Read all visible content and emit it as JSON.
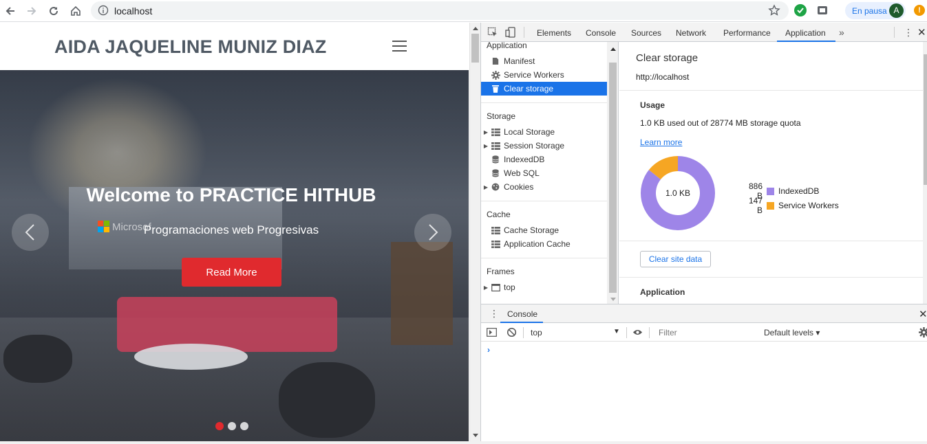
{
  "browser": {
    "url": "localhost",
    "profile_label": "En pausa",
    "avatar_letter": "A",
    "warning_glyph": "!"
  },
  "site": {
    "brand": "AIDA JAQUELINE MUNIZ DIAZ",
    "hero_title": "Welcome to PRACTICE HITHUB",
    "hero_subtitle": "Programaciones web Progresivas",
    "read_more": "Read More",
    "background_logo_text": "Microsof",
    "accent_color": "#e02a2e",
    "carousel_slide_count": 3,
    "carousel_active_index": 0
  },
  "devtools": {
    "tabs": [
      "Elements",
      "Console",
      "Sources",
      "Network",
      "Performance",
      "Application"
    ],
    "active_tab": "Application",
    "more_glyph": "»",
    "sidebar": {
      "application_heading": "Application",
      "application_items": [
        "Manifest",
        "Service Workers",
        "Clear storage"
      ],
      "selected_item": "Clear storage",
      "storage_heading": "Storage",
      "storage_items": [
        "Local Storage",
        "Session Storage",
        "IndexedDB",
        "Web SQL",
        "Cookies"
      ],
      "cache_heading": "Cache",
      "cache_items": [
        "Cache Storage",
        "Application Cache"
      ],
      "frames_heading": "Frames",
      "frames_items": [
        "top"
      ]
    },
    "main": {
      "title": "Clear storage",
      "origin": "http://localhost",
      "usage_heading": "Usage",
      "usage_text": "1.0 KB used out of 28774 MB storage quota",
      "learn_more": "Learn more",
      "donut_center": "1.0 KB",
      "legend": [
        {
          "value": "886 B",
          "label": "IndexedDB",
          "color": "#9e85e8",
          "bytes": 886
        },
        {
          "value": "147 B",
          "label": "Service Workers",
          "color": "#f6a623",
          "bytes": 147
        }
      ],
      "clear_button": "Clear site data",
      "application_heading": "Application"
    },
    "drawer": {
      "tab": "Console",
      "context": "top",
      "filter_placeholder": "Filter",
      "levels": "Default levels ▾",
      "prompt": "›"
    }
  }
}
